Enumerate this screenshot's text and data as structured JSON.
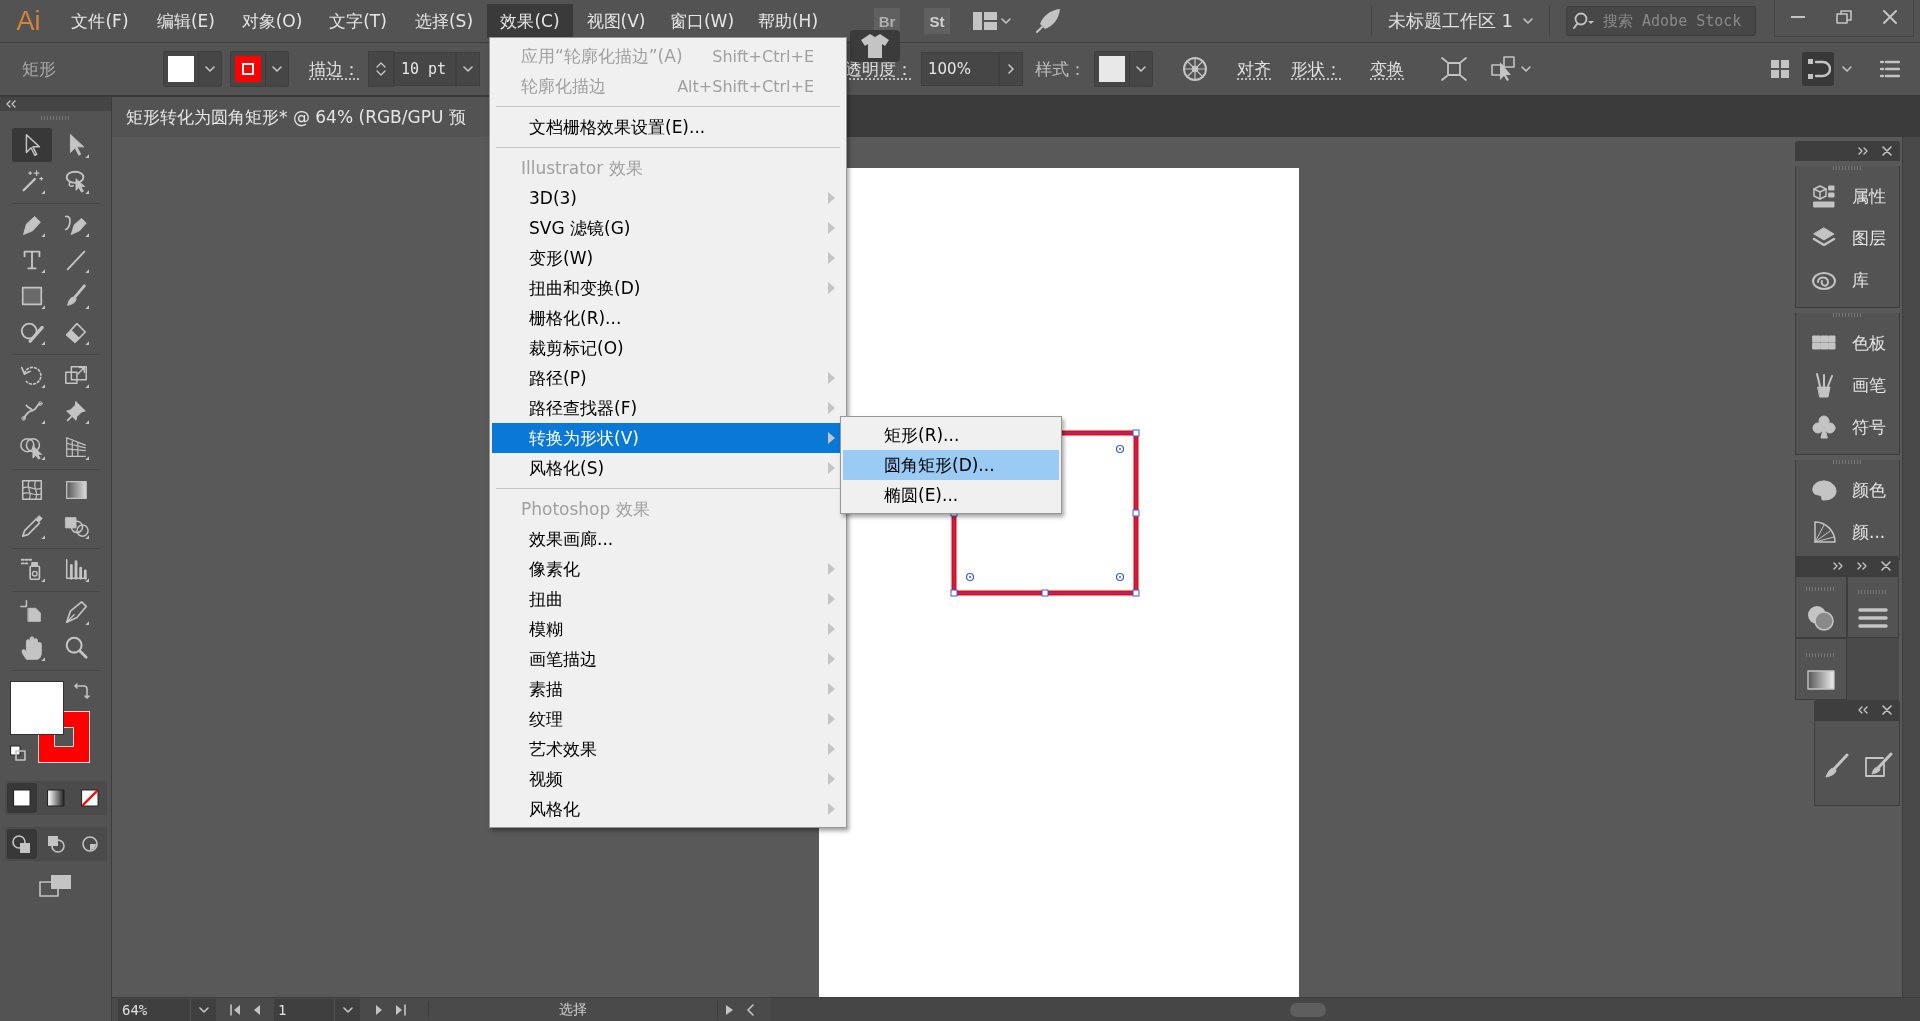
{
  "app_logo": "Ai",
  "menu_bar": {
    "items": [
      {
        "label": "文件(F)",
        "selected": false
      },
      {
        "label": "编辑(E)",
        "selected": false
      },
      {
        "label": "对象(O)",
        "selected": false
      },
      {
        "label": "文字(T)",
        "selected": false
      },
      {
        "label": "选择(S)",
        "selected": false
      },
      {
        "label": "效果(C)",
        "selected": true
      },
      {
        "label": "视图(V)",
        "selected": false
      },
      {
        "label": "窗口(W)",
        "selected": false
      },
      {
        "label": "帮助(H)",
        "selected": false
      }
    ],
    "bridge_button": "Br",
    "stock_button": "St",
    "workspace": "未标题工作区 1",
    "search": {
      "placeholder": "搜索 Adobe Stock"
    }
  },
  "control_bar": {
    "object_type": "矩形",
    "stroke_label": "描边：",
    "stroke_weight": "10 pt",
    "opacity_label": "透明度：",
    "opacity": "100%",
    "style_label": "样式：",
    "align_link": "对齐",
    "shape_link": "形状：",
    "transform_link": "变换"
  },
  "document_tab": {
    "title": "矩形转化为圆角矩形* @ 64% (RGB/GPU 预"
  },
  "toolbar": {
    "groups": [
      {
        "tools": [
          {
            "selected": true
          },
          {
            "selected": false
          },
          {
            "selected": false
          },
          {
            "selected": false
          }
        ]
      },
      {
        "tools": [
          {
            "selected": false
          },
          {
            "selected": false
          },
          {
            "selected": false
          },
          {
            "selected": false
          },
          {
            "selected": false
          },
          {
            "selected": false
          },
          {
            "selected": false
          },
          {
            "selected": false
          }
        ]
      },
      {
        "tools": [
          {
            "selected": false
          },
          {
            "selected": false
          },
          {
            "selected": false
          },
          {
            "selected": false
          },
          {
            "selected": false
          },
          {
            "selected": false
          }
        ]
      },
      {
        "tools": [
          {
            "selected": false
          },
          {
            "selected": false
          },
          {
            "selected": false
          },
          {
            "selected": false
          }
        ]
      },
      {
        "tools": [
          {
            "selected": false
          },
          {
            "selected": false
          }
        ]
      },
      {
        "tools": [
          {
            "selected": false
          },
          {
            "selected": false
          },
          {
            "selected": false
          },
          {
            "selected": false
          }
        ]
      }
    ],
    "color_modes": [
      {
        "selected": true
      },
      {
        "selected": false
      },
      {
        "selected": false
      }
    ],
    "draw_modes": [
      {
        "selected": true
      },
      {
        "selected": false
      },
      {
        "selected": false
      }
    ]
  },
  "effect_menu": {
    "sections": [
      {
        "items": [
          {
            "label": "应用“轮廓化描边”(A)",
            "shortcut": "Shift+Ctrl+E",
            "disabled": true,
            "submenu": false,
            "selected": false
          },
          {
            "label": "轮廓化描边",
            "shortcut": "Alt+Shift+Ctrl+E",
            "disabled": true,
            "submenu": false,
            "selected": false
          }
        ]
      },
      {
        "items": [
          {
            "label": "文档栅格效果设置(E)...",
            "disabled": false,
            "submenu": false,
            "selected": false
          }
        ]
      },
      {
        "header": "Illustrator 效果",
        "items": [
          {
            "label": "3D(3)",
            "disabled": false,
            "submenu": true,
            "selected": false
          },
          {
            "label": "SVG 滤镜(G)",
            "disabled": false,
            "submenu": true,
            "selected": false
          },
          {
            "label": "变形(W)",
            "disabled": false,
            "submenu": true,
            "selected": false
          },
          {
            "label": "扭曲和变换(D)",
            "disabled": false,
            "submenu": true,
            "selected": false
          },
          {
            "label": "栅格化(R)...",
            "disabled": false,
            "submenu": false,
            "selected": false
          },
          {
            "label": "裁剪标记(O)",
            "disabled": false,
            "submenu": false,
            "selected": false
          },
          {
            "label": "路径(P)",
            "disabled": false,
            "submenu": true,
            "selected": false
          },
          {
            "label": "路径查找器(F)",
            "disabled": false,
            "submenu": true,
            "selected": false
          },
          {
            "label": "转换为形状(V)",
            "disabled": false,
            "submenu": true,
            "selected": true
          },
          {
            "label": "风格化(S)",
            "disabled": false,
            "submenu": true,
            "selected": false
          }
        ]
      },
      {
        "header": "Photoshop 效果",
        "items": [
          {
            "label": "效果画廊...",
            "disabled": false,
            "submenu": false,
            "selected": false
          },
          {
            "label": "像素化",
            "disabled": false,
            "submenu": true,
            "selected": false
          },
          {
            "label": "扭曲",
            "disabled": false,
            "submenu": true,
            "selected": false
          },
          {
            "label": "模糊",
            "disabled": false,
            "submenu": true,
            "selected": false
          },
          {
            "label": "画笔描边",
            "disabled": false,
            "submenu": true,
            "selected": false
          },
          {
            "label": "素描",
            "disabled": false,
            "submenu": true,
            "selected": false
          },
          {
            "label": "纹理",
            "disabled": false,
            "submenu": true,
            "selected": false
          },
          {
            "label": "艺术效果",
            "disabled": false,
            "submenu": true,
            "selected": false
          },
          {
            "label": "视频",
            "disabled": false,
            "submenu": true,
            "selected": false
          },
          {
            "label": "风格化",
            "disabled": false,
            "submenu": true,
            "selected": false
          }
        ]
      }
    ]
  },
  "convert_submenu": {
    "items": [
      {
        "label": "矩形(R)...",
        "selected": false
      },
      {
        "label": "圆角矩形(D)...",
        "selected": true
      },
      {
        "label": "椭圆(E)...",
        "selected": false
      }
    ]
  },
  "right_dock": {
    "groups": [
      {
        "items": [
          {
            "label": "属性"
          },
          {
            "label": "图层"
          },
          {
            "label": "库"
          }
        ]
      },
      {
        "items": [
          {
            "label": "色板"
          },
          {
            "label": "画笔"
          },
          {
            "label": "符号"
          }
        ]
      },
      {
        "items": [
          {
            "label": "颜色"
          },
          {
            "label": "颜..."
          }
        ]
      }
    ]
  },
  "status_bar": {
    "zoom": "64%",
    "artboard": "1",
    "tool": "选择"
  }
}
